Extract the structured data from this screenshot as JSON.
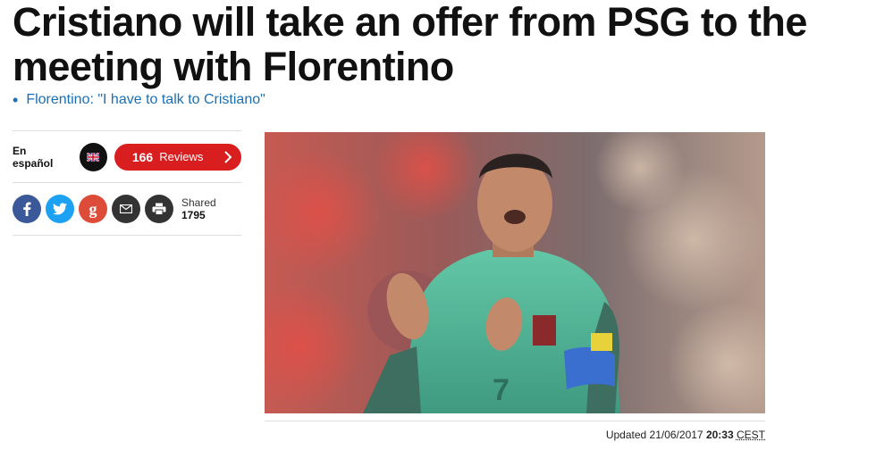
{
  "article": {
    "headline": "Cristiano will take an offer from PSG to the meeting with Florentino",
    "related_link": "Florentino: \"I have to talk to Cristiano\""
  },
  "sidebar": {
    "language_label": "En español",
    "reviews": {
      "count": "166",
      "label": "Reviews"
    },
    "share": {
      "buttons": [
        {
          "icon": "facebook-icon"
        },
        {
          "icon": "twitter-icon"
        },
        {
          "icon": "google-plus-icon"
        },
        {
          "icon": "email-icon"
        },
        {
          "icon": "print-icon"
        }
      ],
      "shared_label": "Shared",
      "shared_count": "1795"
    }
  },
  "meta": {
    "updated_label": "Updated",
    "updated_date": "21/06/2017",
    "updated_time": "20:33",
    "timezone": "CEST"
  },
  "colors": {
    "accent_red": "#d81e1e",
    "link_blue": "#1b6fb3",
    "facebook": "#3b5998",
    "twitter": "#1da1f2",
    "google": "#dd4b39"
  }
}
